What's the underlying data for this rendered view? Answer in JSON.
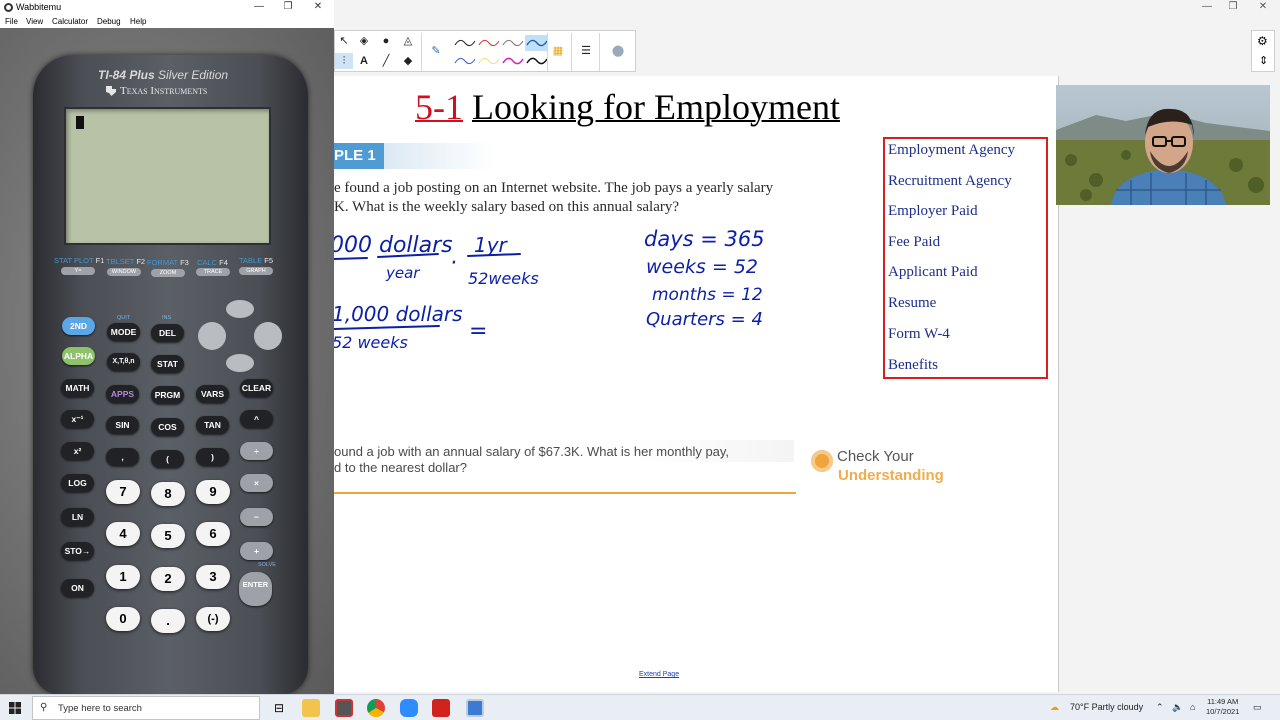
{
  "calculator_window": {
    "title": "Wabbitemu",
    "menu": [
      "File",
      "View",
      "Calculator",
      "Debug",
      "Help"
    ],
    "model": "TI-84 Plus Silver Edition",
    "model_main": "TI-84 Plus",
    "model_edition": "Silver Edition",
    "brand": "Texas Instruments",
    "function_keys": [
      {
        "top": "STAT PLOT",
        "fn": "F1",
        "key": "Y="
      },
      {
        "top": "TBLSET",
        "fn": "F2",
        "key": "WINDOW"
      },
      {
        "top": "FORMAT",
        "fn": "F3",
        "key": "ZOOM"
      },
      {
        "top": "CALC",
        "fn": "F4",
        "key": "TRACE"
      },
      {
        "top": "TABLE",
        "fn": "F5",
        "key": "GRAPH"
      }
    ],
    "keys": {
      "second": "2ND",
      "mode": "MODE",
      "del": "DEL",
      "alpha": "ALPHA",
      "xtn": "X,T,θ,n",
      "stat": "STAT",
      "math": "MATH",
      "apps": "APPS",
      "prgm": "PRGM",
      "vars": "VARS",
      "clear": "CLEAR",
      "inv": "x⁻¹",
      "sin": "SIN",
      "cos": "COS",
      "tan": "TAN",
      "pow": "^",
      "sq": "x²",
      "comma": ",",
      "lparen": "(",
      "rparen": ")",
      "div": "÷",
      "log": "LOG",
      "seven": "7",
      "eight": "8",
      "nine": "9",
      "mul": "×",
      "ln": "LN",
      "four": "4",
      "five": "5",
      "six": "6",
      "minus": "−",
      "sto": "STO→",
      "one": "1",
      "two": "2",
      "three": "3",
      "plus": "+",
      "on": "ON",
      "zero": "0",
      "dot": ".",
      "neg": "(-)",
      "enter": "ENTER",
      "quit": "QUIT",
      "ins": "INS",
      "solve": "SOLVE"
    }
  },
  "whiteboard": {
    "title_number": "5-1",
    "title_text": "Looking for Employment",
    "example_tab": "PLE 1",
    "problem_line1": "e found a job posting on an Internet website. The job pays a yearly salary",
    "problem_line2": "K. What is the weekly salary based on this annual salary?",
    "handwriting": {
      "conv1_num": "000 dollars",
      "conv1_den": "year",
      "conv1_dot": "·",
      "conv2_num": "1yr",
      "conv2_den": "52weeks",
      "result_num": "1,000 dollars",
      "result_den": "52 weeks",
      "equals": "=",
      "facts": [
        "days = 365",
        "weeks = 52",
        "months = 12",
        "Quarters = 4"
      ]
    },
    "vocab_terms": [
      "Employment Agency",
      "Recruitment Agency",
      "Employer Paid",
      "Fee Paid",
      "Applicant Paid",
      "Resume",
      "Form W-4",
      "Benefits"
    ],
    "cyu_line1": "ound a job with an annual salary of $67.3K. What is her monthly pay,",
    "cyu_line2": "d to the nearest dollar?",
    "cyu_badge_1": "Check Your",
    "cyu_badge_2": "Understanding",
    "extend_link": "Extend Page"
  },
  "taskbar": {
    "search_placeholder": "Type here to search",
    "weather": "70°F  Partly cloudy",
    "time": "11:49 AM",
    "date": "10/7/2021"
  },
  "colors": {
    "title_number": "#d10f1f",
    "vocab_border": "#d81e1e",
    "vocab_text": "#1d2f8a",
    "handwriting": "#0b1fa8",
    "accent_orange": "#f0a43b",
    "example_blue": "#4e9cd3"
  }
}
